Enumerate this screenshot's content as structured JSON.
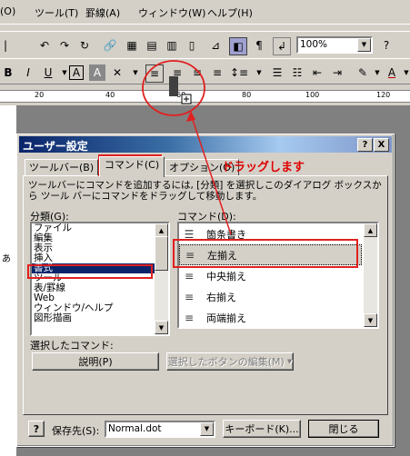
{
  "menubar": {
    "items": [
      {
        "label": "(O)"
      },
      {
        "label": "ツール(T)"
      },
      {
        "label": "罫線(A)"
      },
      {
        "label": "ウィンドウ(W)"
      },
      {
        "label": "ヘルプ(H)"
      }
    ]
  },
  "toolbar1": {
    "zoom_value": "100%"
  },
  "toolbar2": {
    "bold": "B",
    "italic": "I",
    "underline": "U",
    "char_box": "A"
  },
  "ruler": {
    "numbers": [
      "20",
      "40",
      "60",
      "80",
      "100",
      "120"
    ]
  },
  "doc": {
    "edge_char": "あ"
  },
  "annotation": {
    "drag_text": "ドラッグします"
  },
  "dialog": {
    "title": "ユーザー設定",
    "help_btn": "?",
    "close_btn": "X",
    "tabs": [
      {
        "label": "ツールバー(B)"
      },
      {
        "label": "コマンド(C)"
      },
      {
        "label": "オプション(O)"
      }
    ],
    "description": "ツールバーにコマンドを追加するには, [分類] を選択しこのダイアログ ボックスから ツール バーにコマンドをドラッグして移動します。",
    "category_label": "分類(G):",
    "command_label": "コマンド(D):",
    "categories": [
      "ファイル",
      "編集",
      "表示",
      "挿入",
      "書式",
      "ツール",
      "表/罫線",
      "Web",
      "ウィンドウ/ヘルプ",
      "図形描画"
    ],
    "selected_category": "書式",
    "commands": [
      {
        "icon": "bullet-list-icon",
        "glyph": "☰",
        "label": "箇条書き"
      },
      {
        "icon": "align-left-icon",
        "glyph": "≡",
        "label": "左揃え"
      },
      {
        "icon": "align-center-icon",
        "glyph": "≡",
        "label": "中央揃え"
      },
      {
        "icon": "align-right-icon",
        "glyph": "≡",
        "label": "右揃え"
      },
      {
        "icon": "justify-icon",
        "glyph": "≡",
        "label": "両端揃え"
      }
    ],
    "selected_command_label": "選択したコマンド:",
    "description_btn": "説明(P)",
    "modify_btn": "選択したボタンの編集(M)",
    "save_in_label": "保存先(S):",
    "save_in_value": "Normal.dot",
    "keyboard_btn": "キーボード(K)...",
    "close_label": "閉じる"
  }
}
